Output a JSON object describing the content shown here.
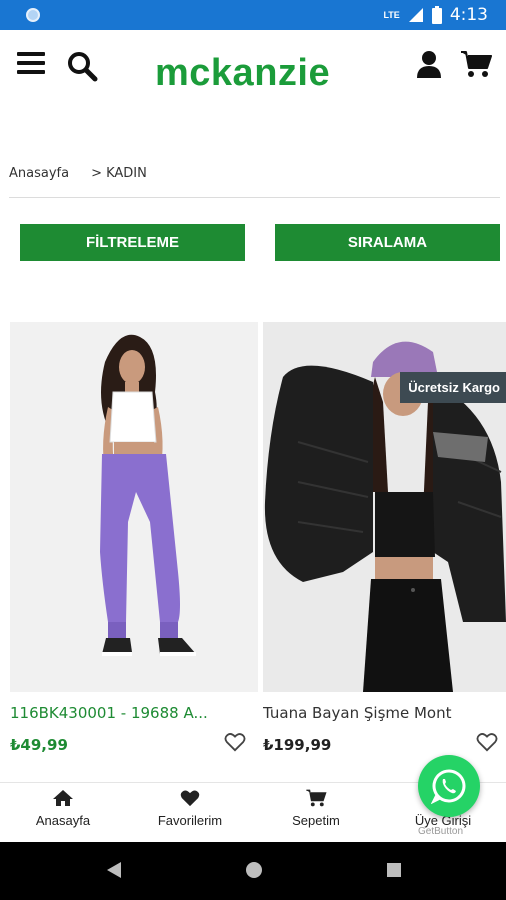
{
  "status_bar": {
    "network": "LTE",
    "time": "4:13",
    "color": "#1976d2"
  },
  "header": {
    "brand": "mckanzie",
    "brand_color": "#1b9c3a",
    "icons": [
      "menu-icon",
      "search-icon",
      "user-icon",
      "cart-icon"
    ]
  },
  "breadcrumb": {
    "home": "Anasayfa",
    "current": "> KADIN"
  },
  "actions": {
    "filter_label": "FİLTRELEME",
    "sort_label": "SIRALAMA",
    "color": "#1e8b33"
  },
  "products": [
    {
      "name": "116BK430001 - 19688 A...",
      "price": "₺49,99",
      "badge": ""
    },
    {
      "name": "Tuana Bayan Şişme Mont",
      "price": "₺199,99",
      "badge": "Ücretsiz Kargo"
    }
  ],
  "bottom_nav": {
    "home": "Anasayfa",
    "favorites": "Favorilerim",
    "cart": "Sepetim",
    "login": "Üye Girişi"
  },
  "whatsapp": {
    "watermark": "GetButton",
    "color": "#25d366"
  }
}
